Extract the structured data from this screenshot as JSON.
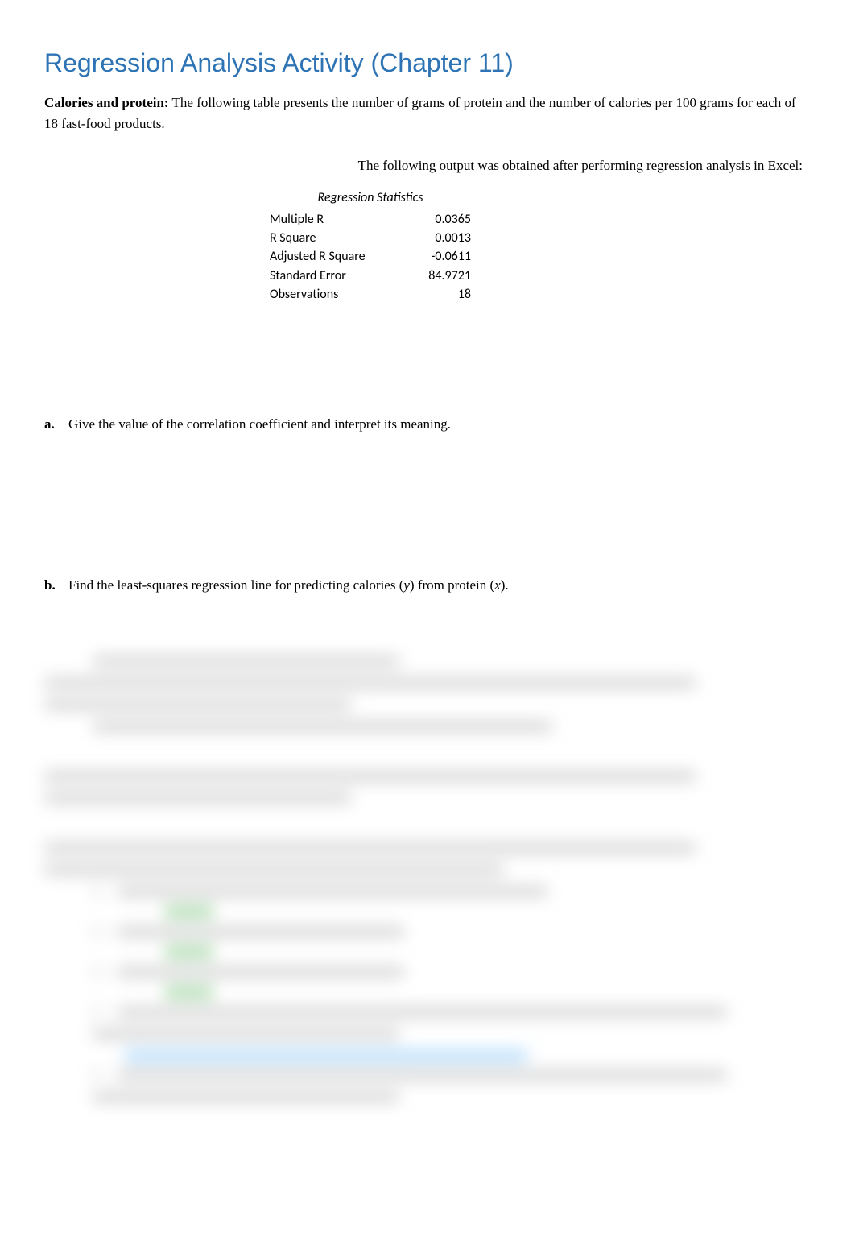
{
  "title": "Regression Analysis Activity (Chapter 11)",
  "intro": {
    "lead": "Calories and protein:",
    "text": "  The following table presents the number of grams of protein and the number of calories per 100 grams for each of 18 fast-food products."
  },
  "excel_note": "The following output was obtained after performing regression analysis in Excel:",
  "stats": {
    "header": "Regression Statistics",
    "rows": [
      {
        "label": "Multiple R",
        "value": "0.0365"
      },
      {
        "label": "R Square",
        "value": "0.0013"
      },
      {
        "label": "Adjusted R Square",
        "value": "-0.0611"
      },
      {
        "label": "Standard Error",
        "value": "84.9721"
      },
      {
        "label": "Observations",
        "value": "18"
      }
    ]
  },
  "questions": {
    "a": {
      "label": "a.",
      "text": "Give the value of the correlation coefficient and interpret its meaning."
    },
    "b": {
      "label": "b.",
      "prefix": "Find the least-squares regression line for predicting calories (",
      "y": "y",
      "mid": ") from protein (",
      "x": "x",
      "suffix": ")."
    }
  }
}
